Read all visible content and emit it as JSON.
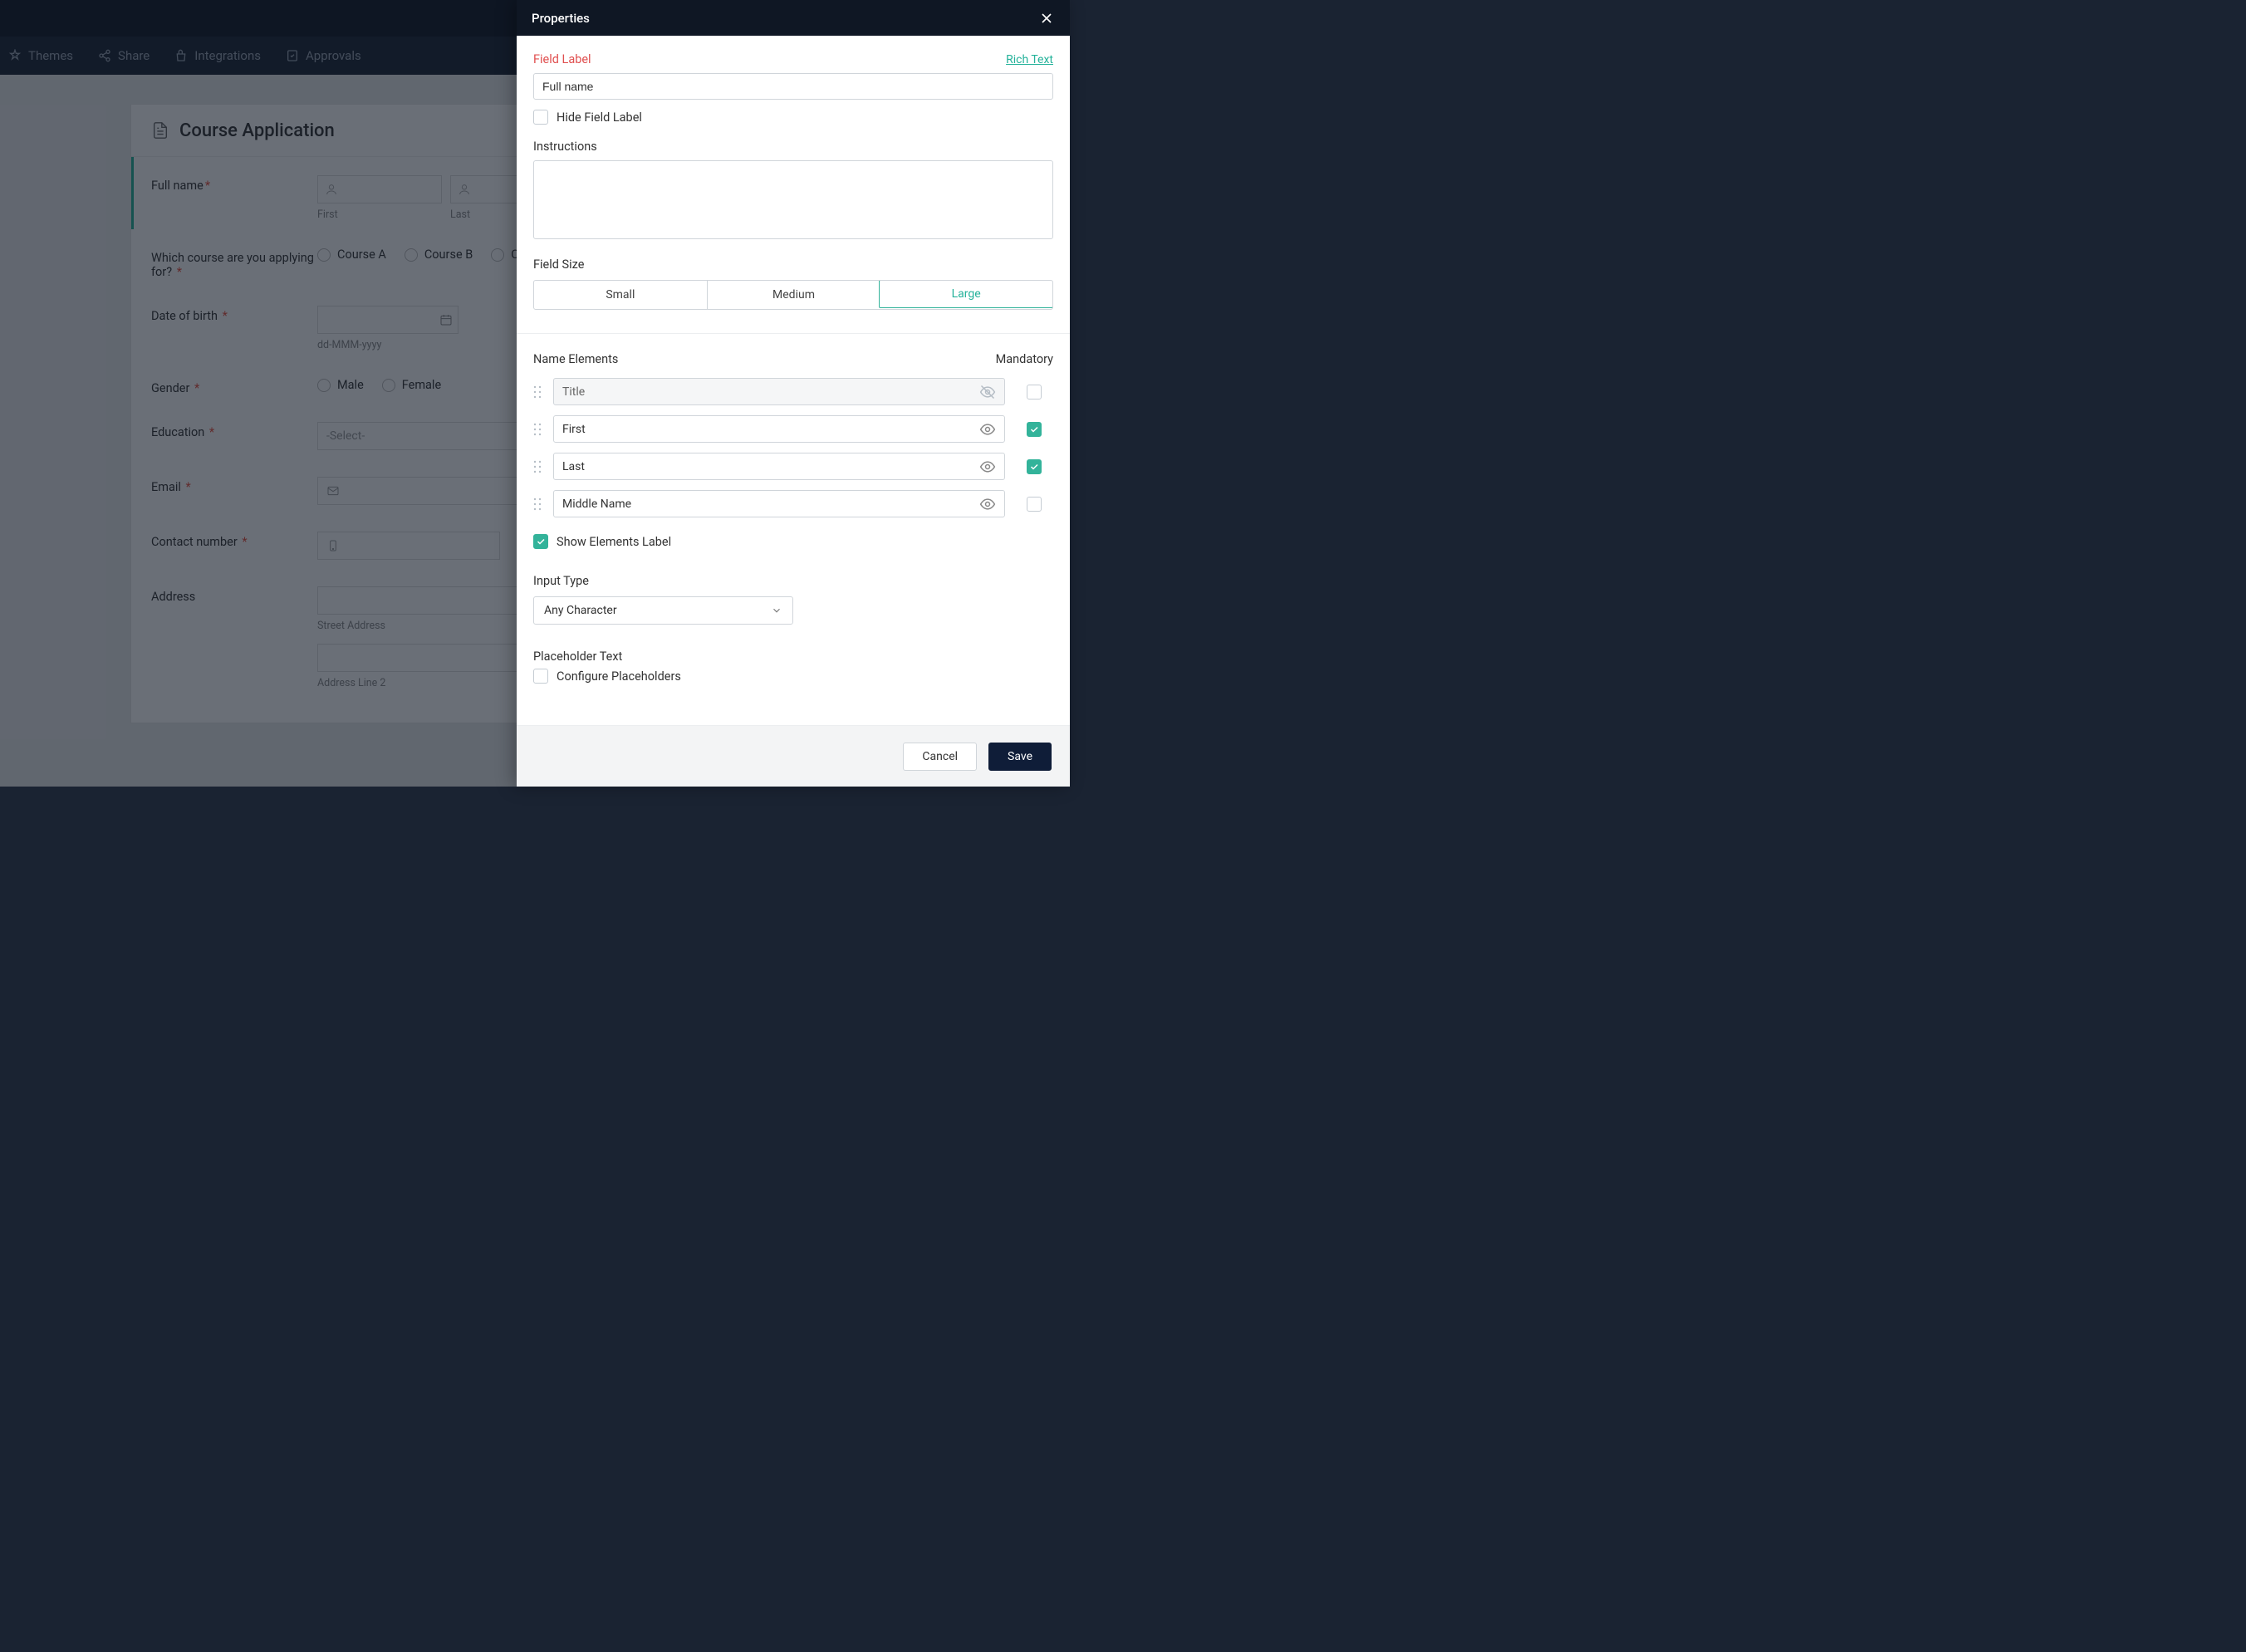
{
  "topbar": {
    "themes": "Themes",
    "share": "Share",
    "integrations": "Integrations",
    "approvals": "Approvals"
  },
  "form": {
    "title": "Course Application",
    "fields": {
      "fullname": {
        "label": "Full name",
        "first": "First",
        "last": "Last"
      },
      "course": {
        "label": "Which course are you applying for?",
        "a": "Course A",
        "b": "Course B",
        "c": "Cou"
      },
      "dob": {
        "label": "Date of birth",
        "format": "dd-MMM-yyyy"
      },
      "gender": {
        "label": "Gender",
        "male": "Male",
        "female": "Female"
      },
      "education": {
        "label": "Education",
        "placeholder": "-Select-"
      },
      "email": {
        "label": "Email"
      },
      "contact": {
        "label": "Contact number"
      },
      "address": {
        "label": "Address",
        "line1": "Street Address",
        "line2": "Address Line 2"
      }
    }
  },
  "panel": {
    "title": "Properties",
    "fieldLabel": {
      "label": "Field Label",
      "value": "Full name",
      "rich": "Rich Text",
      "hide": "Hide Field Label"
    },
    "instructions": {
      "label": "Instructions",
      "value": ""
    },
    "fieldSize": {
      "label": "Field Size",
      "small": "Small",
      "medium": "Medium",
      "large": "Large",
      "selected": "large"
    },
    "nameElements": {
      "label": "Name Elements",
      "mandatory": "Mandatory",
      "items": {
        "title": "Title",
        "first": "First",
        "last": "Last",
        "middle": "Middle Name"
      },
      "showLabel": "Show Elements Label"
    },
    "inputType": {
      "label": "Input Type",
      "value": "Any Character"
    },
    "placeholder": {
      "label": "Placeholder Text",
      "configure": "Configure Placeholders"
    },
    "buttons": {
      "cancel": "Cancel",
      "save": "Save"
    }
  }
}
